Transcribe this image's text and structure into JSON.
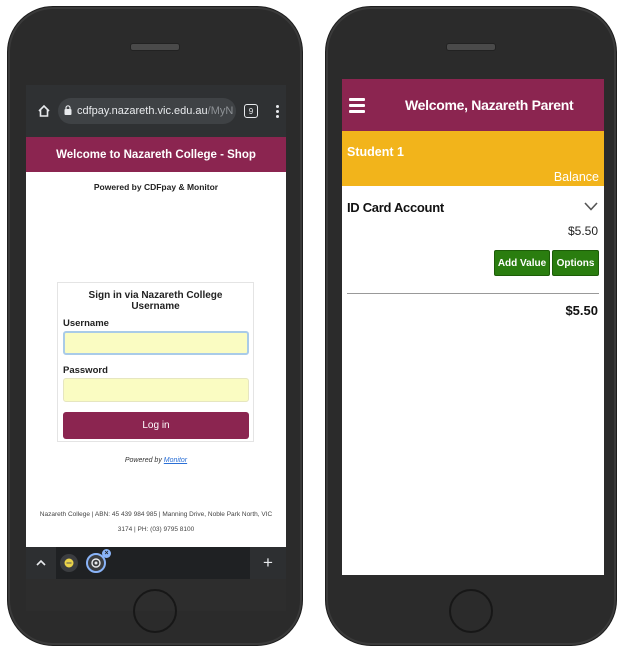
{
  "browser": {
    "url_main": "cdfpay.nazareth.vic.edu.au",
    "url_rest": "/MyN",
    "tab_count": "9"
  },
  "shop": {
    "header": "Welcome to Nazareth College - Shop",
    "powered_top": "Powered by CDFpay & Monitor",
    "login_title": "Sign in via Nazareth College Username",
    "username_label": "Username",
    "password_label": "Password",
    "login_button": "Log in",
    "powered_by": "Powered by",
    "powered_link": "Monitor",
    "footer_line1": "Nazareth College | ABN: 45 439 984 985 | Manning Drive, Noble Park North, VIC",
    "footer_line2": "3174 | PH: (03) 9795 8100"
  },
  "app": {
    "title": "Welcome, Nazareth Parent",
    "student_name": "Student 1",
    "balance_label": "Balance",
    "account_name": "ID Card Account",
    "account_amount": "$5.50",
    "add_value": "Add Value",
    "options": "Options",
    "total": "$5.50"
  },
  "colors": {
    "brand": "#8b2550",
    "student_band": "#f2b41b",
    "button_green": "#2a7d0f",
    "input_fill": "#fafcc2"
  }
}
